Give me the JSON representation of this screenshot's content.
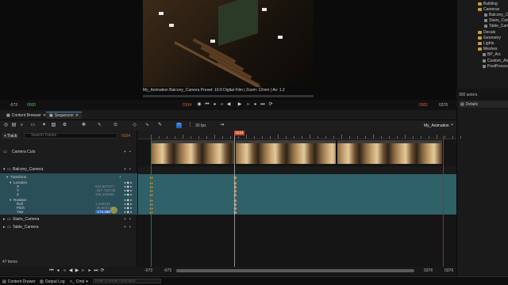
{
  "viewport": {
    "info": "My_Animation Balcony_Camera   Preset: 16:9 Digital Film | Zoom: 12mm | Av: 1.2",
    "frame": "0104",
    "scrub_progress": 0.0
  },
  "outliner": {
    "items": [
      {
        "label": "Building",
        "kind": "folder"
      },
      {
        "label": "Cameras",
        "kind": "folder"
      },
      {
        "label": "Balcony_Cam",
        "kind": "actor"
      },
      {
        "label": "Stairs_Cam",
        "kind": "actor"
      },
      {
        "label": "Table_Cam",
        "kind": "actor"
      },
      {
        "label": "Decals",
        "kind": "folder"
      },
      {
        "label": "Geometry",
        "kind": "folder"
      },
      {
        "label": "Lights",
        "kind": "folder"
      },
      {
        "label": "Meshes",
        "kind": "folder"
      },
      {
        "label": "BP_Arc",
        "kind": "actor"
      },
      {
        "label": "Custom_Atm",
        "kind": "actor"
      },
      {
        "label": "PostProcessV",
        "kind": "actor"
      }
    ],
    "actor_count": "300 actors"
  },
  "details": {
    "tab": "Details"
  },
  "transport": {
    "start": "-073",
    "start_green": "0000",
    "current": "0104",
    "end_red": "0301",
    "end": "0376",
    "buttons": [
      "skip-start",
      "prev-key",
      "step-back",
      "play-reverse",
      "play",
      "step-forward",
      "next-key",
      "skip-end",
      "loop"
    ]
  },
  "tabs": {
    "content_browser": "Content Browser",
    "sequencer": "Sequencer"
  },
  "toolbar": {
    "fps": "30 fps",
    "sequence_name": "My_Animation",
    "current_frame": "0104"
  },
  "tracks": {
    "add_track": "Track",
    "search_placeholder": "Search Tracks",
    "frame_readout": "0104",
    "rows": {
      "camera_cuts": "Camera Cuts",
      "balcony_camera": "Balcony_Camera",
      "transform": "Transform",
      "location": "Location",
      "x": "X",
      "y": "Y",
      "z": "Z",
      "rotation": "Rotation",
      "roll": "Roll",
      "pitch": "Pitch",
      "yaw": "Yaw",
      "stairs_camera": "Stairs_Camera",
      "table_camera": "Table_Camera"
    },
    "values": {
      "x": "664.867577",
      "y": "-397.746738",
      "z": "205.353695",
      "roll": "1.648333",
      "pitch": "-26.804315",
      "yaw": "-173.488"
    },
    "items_count": "47 items"
  },
  "timeline": {
    "start_label": "-073",
    "start2": "-073",
    "end_label": "0376",
    "end2": "0376",
    "playhead": "0104"
  },
  "statusbar": {
    "content_drawer": "Content Drawer",
    "output_log": "Output Log",
    "cmd": "Cmd",
    "cmd_placeholder": "Enter Console Command"
  }
}
